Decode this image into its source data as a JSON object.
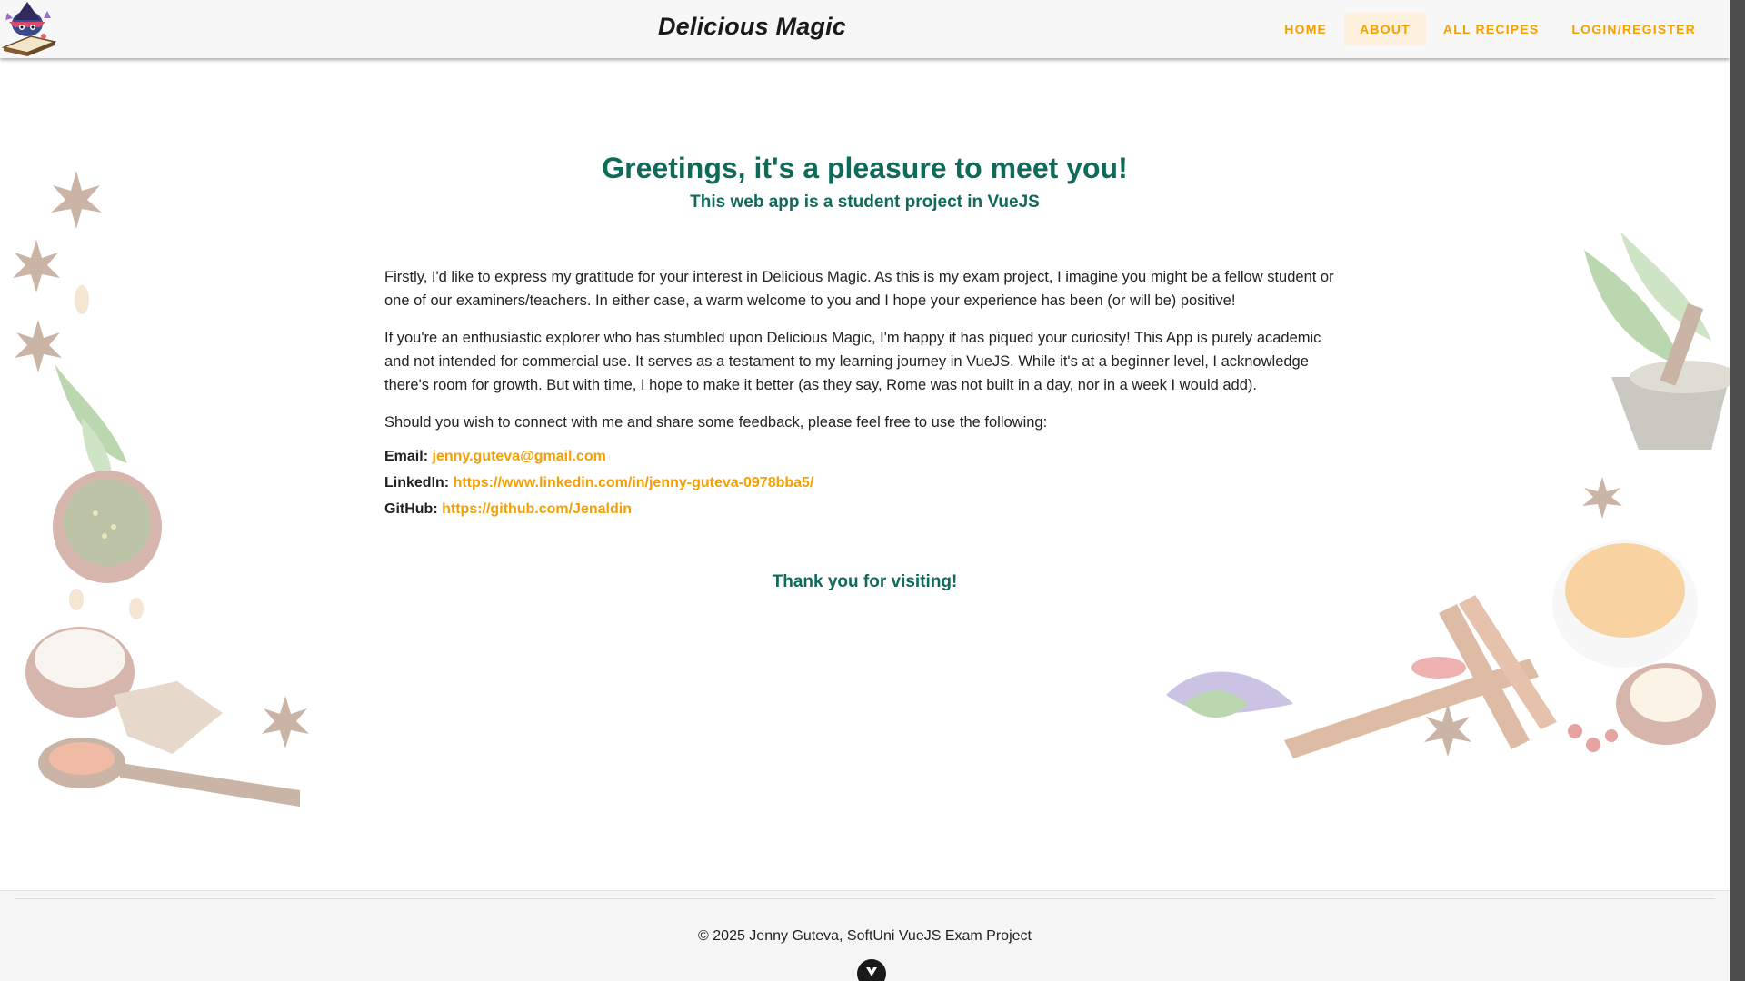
{
  "header": {
    "site_title": "Delicious Magic",
    "logo_icon": "wizard-hat-book-logo",
    "nav": [
      {
        "label": "HOME",
        "active": false
      },
      {
        "label": "ABOUT",
        "active": true
      },
      {
        "label": "ALL RECIPES",
        "active": false
      },
      {
        "label": "LOGIN/REGISTER",
        "active": false
      }
    ]
  },
  "main": {
    "greeting": "Greetings, it's a pleasure to meet you!",
    "subtitle": "This web app is a student project in VueJS",
    "paragraphs": [
      "Firstly, I'd like to express my gratitude for your interest in Delicious Magic. As this is my exam project, I imagine you might be a fellow student or one of our examiners/teachers. In either case, a warm welcome to you and I hope your experience has been (or will be) positive!",
      "If you're an enthusiastic explorer who has stumbled upon Delicious Magic, I'm happy it has piqued your curiosity! This App is purely academic and not intended for commercial use. It serves as a testament to my learning journey in VueJS. While it's at a beginner level, I acknowledge there's room for growth. But with time, I hope to make it better (as they say, Rome was not built in a day, nor in a week I would add).",
      "Should you wish to connect with me and share some feedback, please feel free to use the following:"
    ],
    "contacts": {
      "email_label": "Email:",
      "email_value": "jenny.guteva@gmail.com",
      "linkedin_label": "LinkedIn:",
      "linkedin_value": "https://www.linkedin.com/in/jenny-guteva-0978bba5/",
      "github_label": "GitHub:",
      "github_value": "https://github.com/Jenaldin"
    },
    "thanks": "Thank you for visiting!"
  },
  "footer": {
    "text": "© 2025 Jenny Guteva, SoftUni VueJS Exam Project"
  },
  "colors": {
    "accent": "#f5a000",
    "heading": "#0e6b5a",
    "header_bg": "#f7f7f7",
    "footer_bg": "#f5f5f5"
  },
  "decorations": {
    "left": "spices-and-herbs-left-illustration",
    "right": "spices-and-mortar-right-illustration",
    "badge": "vue-devtools-icon"
  }
}
